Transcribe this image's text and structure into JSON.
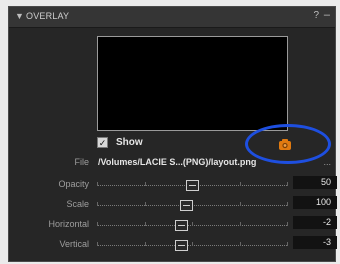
{
  "panel": {
    "title": "OVERLAY",
    "help": "?",
    "minimize": "–"
  },
  "preview": {
    "show_label": "Show",
    "show_checked": true
  },
  "file": {
    "label": "File",
    "path": "/Volumes/LACIE S...(PNG)/layout.png",
    "more": "..."
  },
  "sliders": [
    {
      "label": "Opacity",
      "value": "50",
      "position": 0.5
    },
    {
      "label": "Scale",
      "value": "100",
      "position": 0.47
    },
    {
      "label": "Horizontal",
      "value": "-2",
      "position": 0.44
    },
    {
      "label": "Vertical",
      "value": "-3",
      "position": 0.44
    }
  ],
  "colors": {
    "panel_bg": "#262626",
    "camera_icon": "#e07a10",
    "highlight_ring": "#1e4fe0"
  }
}
